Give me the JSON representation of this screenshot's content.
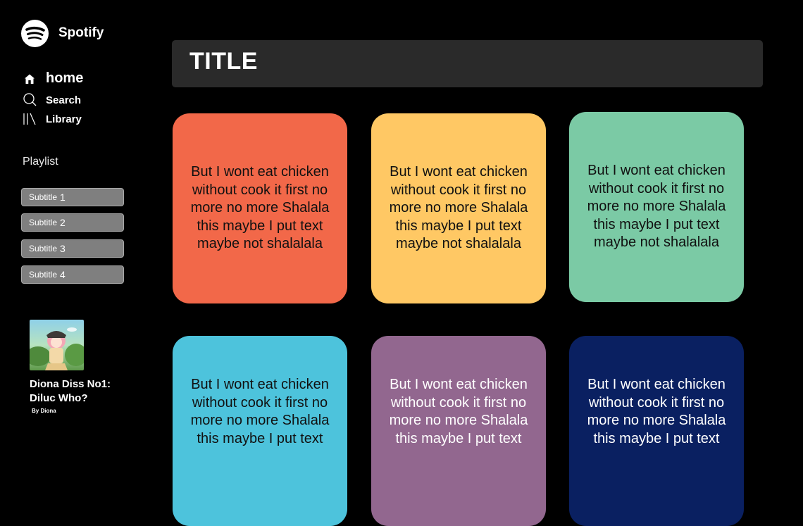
{
  "app": {
    "name": "Spotify"
  },
  "sidebar": {
    "nav": [
      {
        "label": "home",
        "icon": "home-icon"
      },
      {
        "label": "Search",
        "icon": "search-icon"
      },
      {
        "label": "Library",
        "icon": "library-icon"
      }
    ],
    "playlist_heading": "Playlist",
    "playlists": [
      {
        "label": "Subtitle",
        "num": "1"
      },
      {
        "label": "Subtitle",
        "num": "2"
      },
      {
        "label": "Subtitle",
        "num": "3"
      },
      {
        "label": "Subtitle",
        "num": "4"
      }
    ]
  },
  "now_playing": {
    "title": "Diona Diss No1: Diluc Who?",
    "artist": "By Diona"
  },
  "main": {
    "title": "TITLE",
    "cards": [
      {
        "text": "But I wont eat chicken without cook it first no more no more Shalala this maybe I put text maybe not shalalala",
        "color": "#f26849"
      },
      {
        "text": "But I wont eat chicken without cook it first no more no more Shalala this maybe I put text maybe not shalalala",
        "color": "#ffc864"
      },
      {
        "text": "But I wont eat chicken without cook it first no more no more Shalala this maybe I put text maybe not shalalala",
        "color": "#7bcaa5"
      },
      {
        "text": "But I wont eat chicken without cook it first no more no more Shalala this maybe I put text",
        "color": "#4dc3dc"
      },
      {
        "text": "But I wont eat chicken without cook it first no more no more Shalala this maybe I put text",
        "color": "#92678f"
      },
      {
        "text": "But I wont eat chicken without cook it first no more no more Shalala this maybe I put text",
        "color": "#0a2061"
      }
    ]
  }
}
